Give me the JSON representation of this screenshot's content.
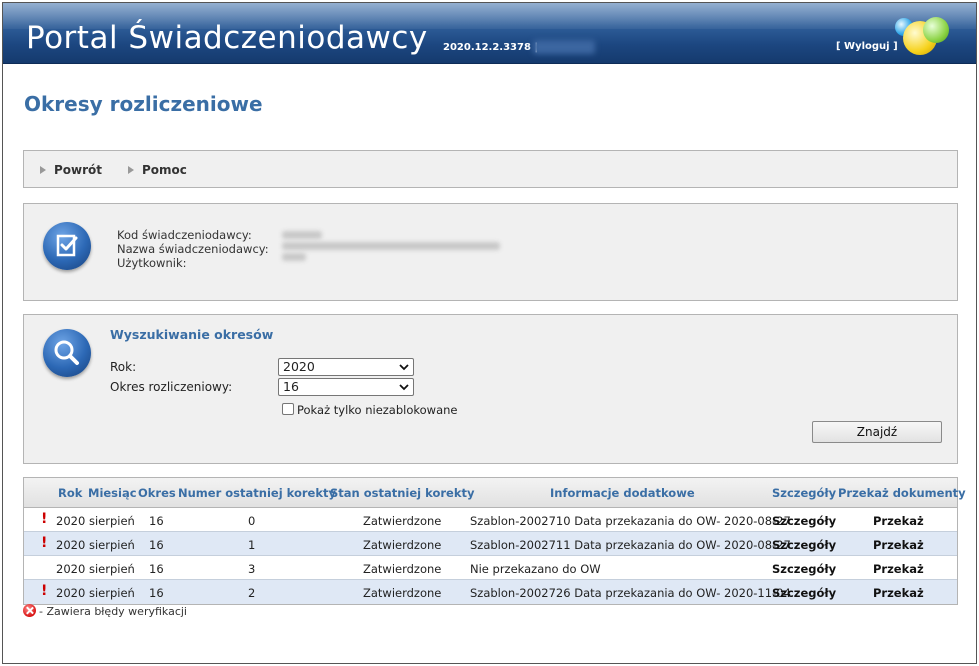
{
  "header": {
    "title": "Portal Świadczeniodawcy",
    "version": "2020.12.2.3378 |",
    "logout": "[ Wyloguj ]"
  },
  "page_title": "Okresy rozliczeniowe",
  "nav": {
    "back": "Powrót",
    "help": "Pomoc"
  },
  "provider_info": {
    "code_label": "Kod świadczeniodawcy:",
    "name_label": "Nazwa świadczeniodawcy:",
    "user_label": "Użytkownik:"
  },
  "search": {
    "heading": "Wyszukiwanie okresów",
    "year_label": "Rok:",
    "year_value": "2020",
    "period_label": "Okres rozliczeniowy:",
    "period_value": "16",
    "checkbox_label": "Pokaż tylko niezablokowane",
    "checkbox_checked": false,
    "find_button": "Znajdź"
  },
  "table": {
    "headers": [
      "Rok",
      "Miesiąc",
      "Okres",
      "Numer ostatniej korekty",
      "Stan ostatniej korekty",
      "Informacje dodatkowe",
      "Szczegóły",
      "Przekaż dokumenty"
    ],
    "rows": [
      {
        "error": "!",
        "year": "2020",
        "month": "sierpień",
        "period": "16",
        "correction": "0",
        "state": "Zatwierdzone",
        "info": "Szablon-2002710 Data przekazania do OW- 2020-08-27",
        "details": "Szczegóły",
        "send": "Przekaż"
      },
      {
        "error": "!",
        "year": "2020",
        "month": "sierpień",
        "period": "16",
        "correction": "1",
        "state": "Zatwierdzone",
        "info": "Szablon-2002711 Data przekazania do OW- 2020-08-27",
        "details": "Szczegóły",
        "send": "Przekaż"
      },
      {
        "error": "",
        "year": "2020",
        "month": "sierpień",
        "period": "16",
        "correction": "3",
        "state": "Zatwierdzone",
        "info": "Nie przekazano do OW",
        "details": "Szczegóły",
        "send": "Przekaż"
      },
      {
        "error": "!",
        "year": "2020",
        "month": "sierpień",
        "period": "16",
        "correction": "2",
        "state": "Zatwierdzone",
        "info": "Szablon-2002726 Data przekazania do OW- 2020-11-04",
        "details": "Szczegóły",
        "send": "Przekaż"
      }
    ]
  },
  "legend": "- Zawiera błędy weryfikacji",
  "colors": {
    "header_blue": "#1c4680",
    "title_blue": "#3a6ea5",
    "row_alt": "#dfe8f5",
    "error_red": "#cc0000"
  }
}
